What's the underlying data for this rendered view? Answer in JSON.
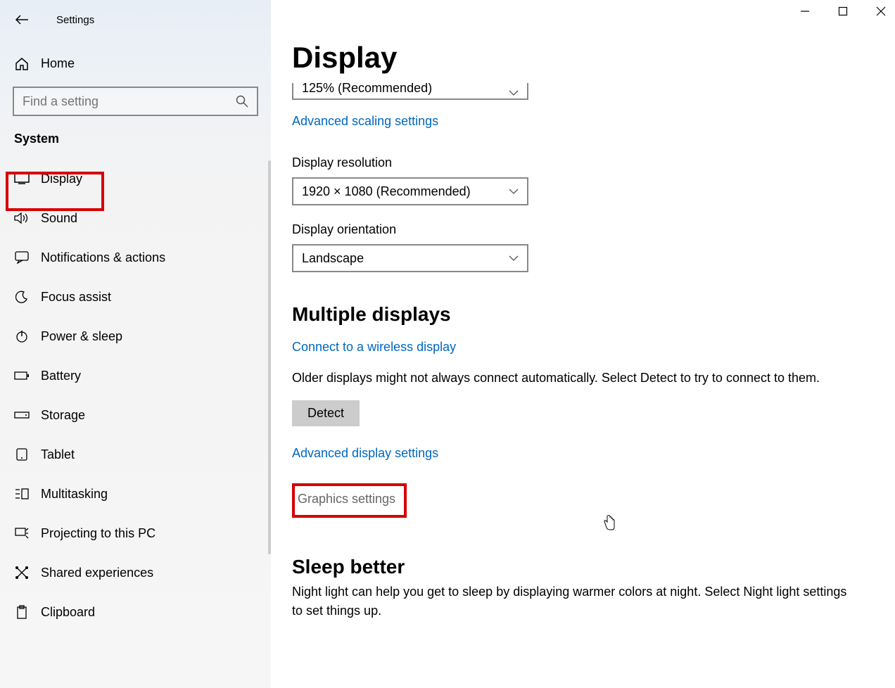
{
  "window": {
    "title": "Settings"
  },
  "sidebar": {
    "home": "Home",
    "search_placeholder": "Find a setting",
    "category": "System",
    "items": [
      {
        "label": "Display"
      },
      {
        "label": "Sound"
      },
      {
        "label": "Notifications & actions"
      },
      {
        "label": "Focus assist"
      },
      {
        "label": "Power & sleep"
      },
      {
        "label": "Battery"
      },
      {
        "label": "Storage"
      },
      {
        "label": "Tablet"
      },
      {
        "label": "Multitasking"
      },
      {
        "label": "Projecting to this PC"
      },
      {
        "label": "Shared experiences"
      },
      {
        "label": "Clipboard"
      }
    ]
  },
  "main": {
    "page_title": "Display",
    "scale_value": "125% (Recommended)",
    "adv_scaling_link": "Advanced scaling settings",
    "resolution_label": "Display resolution",
    "resolution_value": "1920 × 1080 (Recommended)",
    "orientation_label": "Display orientation",
    "orientation_value": "Landscape",
    "multiple_h": "Multiple displays",
    "wireless_link": "Connect to a wireless display",
    "detect_text": "Older displays might not always connect automatically. Select Detect to try to connect to them.",
    "detect_btn": "Detect",
    "adv_display_link": "Advanced display settings",
    "graphics_link": "Graphics settings",
    "sleep_h": "Sleep better",
    "sleep_text": "Night light can help you get to sleep by displaying warmer colors at night. Select Night light settings to set things up."
  }
}
